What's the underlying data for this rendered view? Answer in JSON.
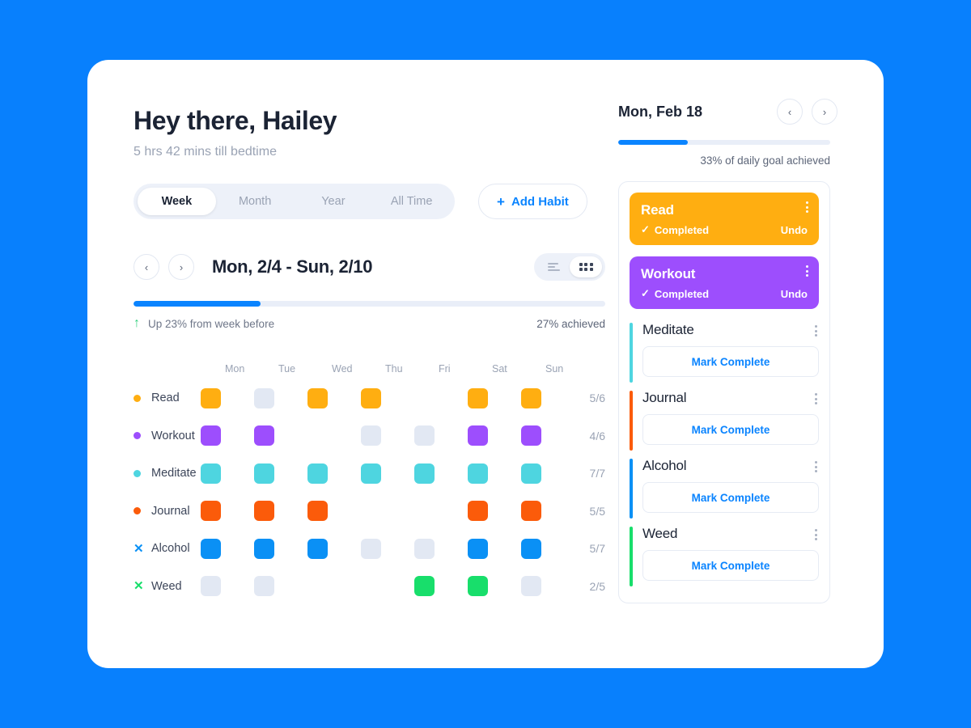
{
  "theme": {
    "page_background": "#0880FD",
    "accent_blue": "#0A84FF",
    "text_dark": "#1B2334",
    "text_muted": "#9AA3B4",
    "cell_missed": "#E2E8F3"
  },
  "header": {
    "greeting": "Hey there, Hailey",
    "subtitle": "5 hrs 42 mins till bedtime"
  },
  "range_tabs": {
    "items": [
      {
        "label": "Week",
        "active": true
      },
      {
        "label": "Month",
        "active": false
      },
      {
        "label": "Year",
        "active": false
      },
      {
        "label": "All Time",
        "active": false
      }
    ]
  },
  "add_habit": {
    "label": "Add Habit",
    "plus": "+"
  },
  "week_nav": {
    "prev": "‹",
    "next": "›",
    "range_label": "Mon, 2/4 - Sun, 2/10",
    "view_list_icon": "list-icon",
    "view_grid_icon": "grid-icon",
    "active_view": "grid"
  },
  "week_summary": {
    "progress_percent": 27,
    "trend_arrow": "↑",
    "trend_text": "Up 23% from week before",
    "achieved_text": "27% achieved"
  },
  "grid": {
    "days": [
      "Mon",
      "Tue",
      "Wed",
      "Thu",
      "Fri",
      "Sat",
      "Sun"
    ],
    "rows": [
      {
        "name": "Read",
        "color": "#FFAE11",
        "marker": "dot",
        "cells": [
          "done",
          "missed",
          "done",
          "done",
          "none",
          "done",
          "done"
        ],
        "count": "5/6"
      },
      {
        "name": "Workout",
        "color": "#9D4EFD",
        "marker": "dot",
        "cells": [
          "done",
          "done",
          "none",
          "missed",
          "missed",
          "done",
          "done"
        ],
        "count": "4/6"
      },
      {
        "name": "Meditate",
        "color": "#4ED5E0",
        "marker": "dot",
        "cells": [
          "done",
          "done",
          "done",
          "done",
          "done",
          "done",
          "done"
        ],
        "count": "7/7"
      },
      {
        "name": "Journal",
        "color": "#FB5B0A",
        "marker": "dot",
        "cells": [
          "done",
          "done",
          "done",
          "none",
          "none",
          "done",
          "done"
        ],
        "count": "5/5"
      },
      {
        "name": "Alcohol",
        "color": "#0A90F5",
        "marker": "x",
        "cells": [
          "done",
          "done",
          "done",
          "missed",
          "missed",
          "done",
          "done"
        ],
        "count": "5/7"
      },
      {
        "name": "Weed",
        "color": "#18DE6B",
        "marker": "x",
        "cells": [
          "missed",
          "missed",
          "none",
          "none",
          "done",
          "done",
          "missed"
        ],
        "count": "2/5"
      }
    ]
  },
  "day_panel": {
    "date_label": "Mon, Feb 18",
    "prev": "‹",
    "next": "›",
    "progress_percent": 33,
    "goal_text": "33% of daily goal achieved",
    "completed_label": "Completed",
    "check_glyph": "✓",
    "undo_label": "Undo",
    "mark_complete_label": "Mark Complete",
    "habits": [
      {
        "name": "Read",
        "color": "#FFAE11",
        "status": "completed"
      },
      {
        "name": "Workout",
        "color": "#9D4EFD",
        "status": "completed"
      },
      {
        "name": "Meditate",
        "color": "#4ED5E0",
        "status": "todo"
      },
      {
        "name": "Journal",
        "color": "#FB5B0A",
        "status": "todo"
      },
      {
        "name": "Alcohol",
        "color": "#0A90F5",
        "status": "todo"
      },
      {
        "name": "Weed",
        "color": "#18DE6B",
        "status": "todo"
      }
    ]
  }
}
